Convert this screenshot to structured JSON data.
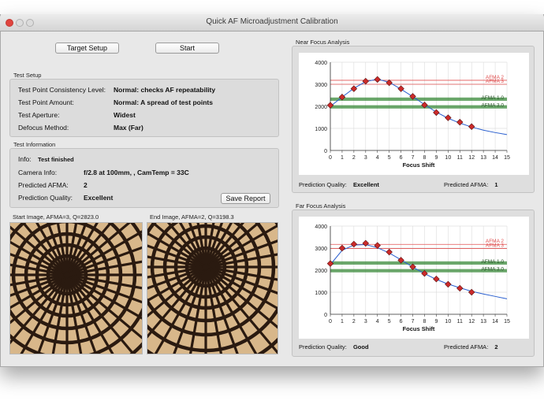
{
  "window": {
    "title": "Quick AF Microadjustment Calibration"
  },
  "toolbar": {
    "target_setup_label": "Target Setup",
    "start_label": "Start"
  },
  "test_setup": {
    "group_label": "Test Setup",
    "rows": [
      {
        "label": "Test Point Consistency Level:",
        "value": "Normal: checks AF repeatability"
      },
      {
        "label": "Test Point Amount:",
        "value": "Normal: A spread of test points"
      },
      {
        "label": "Test Aperture:",
        "value": "Widest"
      },
      {
        "label": "Defocus Method:",
        "value": "Max (Far)"
      }
    ]
  },
  "test_info": {
    "group_label": "Test Information",
    "info_label": "Info:",
    "info_value": "Test finished",
    "camera_label": "Camera Info:",
    "camera_value": "f/2.8 at 100mm, , CamTemp = 33C",
    "afma_label": "Predicted AFMA:",
    "afma_value": "2",
    "quality_label": "Prediction Quality:",
    "quality_value": "Excellent",
    "save_report_label": "Save Report"
  },
  "images": {
    "start_label": "Start Image, AFMA=3, Q=2823.0",
    "end_label": "End Image, AFMA=2, Q=3198.3"
  },
  "colors": {
    "pattern_dark": "#2a1a10",
    "pattern_light": "#d8b78a",
    "band": "#3a8a3a",
    "afma_line": "#e05050",
    "curve": "#2a5fcf",
    "point": "#cc2b2b"
  },
  "chart_data": [
    {
      "type": "scatter",
      "group_label": "Near Focus Analysis",
      "xlabel": "Focus Shift",
      "xlim": [
        0,
        15
      ],
      "ylim": [
        0,
        4000
      ],
      "xticks": [
        "0",
        "1",
        "2",
        "3",
        "4",
        "5",
        "6",
        "7",
        "8",
        "9",
        "10",
        "11",
        "12",
        "13",
        "14",
        "15"
      ],
      "yticks": [
        "0",
        "1000",
        "2000",
        "3000",
        "4000"
      ],
      "points": {
        "x": [
          0,
          1,
          2,
          3,
          4,
          5,
          6,
          7,
          8,
          9,
          10,
          11,
          12
        ],
        "y": [
          2050,
          2420,
          2800,
          3140,
          3220,
          3070,
          2800,
          2450,
          2060,
          1720,
          1480,
          1280,
          1080
        ]
      },
      "curve": {
        "x": [
          0,
          1,
          2,
          3,
          4,
          5,
          6,
          7,
          8,
          9,
          10,
          11,
          12,
          13,
          14,
          15
        ],
        "y": [
          2000,
          2420,
          2820,
          3120,
          3230,
          3090,
          2780,
          2440,
          2080,
          1740,
          1460,
          1240,
          1060,
          920,
          810,
          720
        ]
      },
      "afma_lines": [
        {
          "label": "AFMA 2",
          "y": 3180
        },
        {
          "label": "AFMA 3",
          "y": 3000
        }
      ],
      "bands": [
        {
          "label": "AFMA 1.0",
          "y1": 2400,
          "y2": 2250
        },
        {
          "label": "AFMA 3.0",
          "y1": 2050,
          "y2": 1900
        }
      ],
      "quality_label": "Prediction Quality:",
      "quality_value": "Excellent",
      "afma_label": "Predicted AFMA:",
      "afma_value": "1"
    },
    {
      "type": "scatter",
      "group_label": "Far Focus Analysis",
      "xlabel": "Focus Shift",
      "xlim": [
        0,
        15
      ],
      "ylim": [
        0,
        4000
      ],
      "xticks": [
        "0",
        "1",
        "2",
        "3",
        "4",
        "5",
        "6",
        "7",
        "8",
        "9",
        "10",
        "11",
        "12",
        "13",
        "14",
        "15"
      ],
      "yticks": [
        "0",
        "1000",
        "2000",
        "3000",
        "4000"
      ],
      "points": {
        "x": [
          0,
          1,
          2,
          3,
          4,
          5,
          6,
          7,
          8,
          9,
          10,
          11,
          12
        ],
        "y": [
          2300,
          3000,
          3180,
          3220,
          3120,
          2820,
          2450,
          2150,
          1850,
          1600,
          1360,
          1180,
          1000
        ]
      },
      "curve": {
        "x": [
          0,
          1,
          2,
          3,
          4,
          5,
          6,
          7,
          8,
          9,
          10,
          11,
          12,
          13,
          14,
          15
        ],
        "y": [
          2250,
          2900,
          3140,
          3160,
          3020,
          2780,
          2470,
          2140,
          1840,
          1580,
          1370,
          1200,
          1040,
          920,
          810,
          700
        ]
      },
      "afma_lines": [
        {
          "label": "AFMA 2",
          "y": 3170
        },
        {
          "label": "AFMA 3",
          "y": 2980
        }
      ],
      "bands": [
        {
          "label": "AFMA 1.0",
          "y1": 2400,
          "y2": 2250
        },
        {
          "label": "AFMA 3.0",
          "y1": 2050,
          "y2": 1900
        }
      ],
      "quality_label": "Prediction Quality:",
      "quality_value": "Good",
      "afma_label": "Predicted AFMA:",
      "afma_value": "2"
    }
  ]
}
